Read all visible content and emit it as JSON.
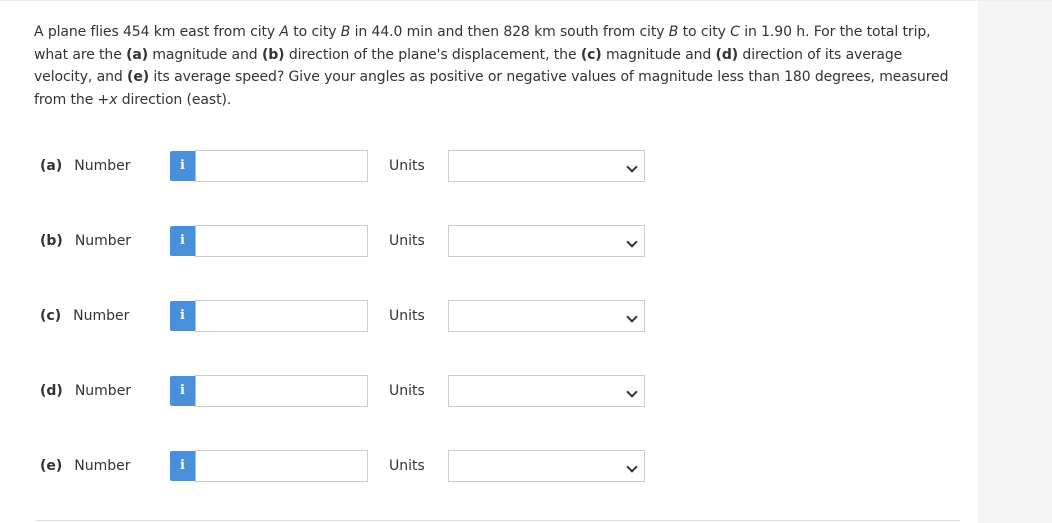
{
  "question": {
    "p1": "A plane flies 454 km east from city ",
    "cityA": "A",
    "p2": " to city ",
    "cityB": "B",
    "p3": " in 44.0 min and then 828 km south from city ",
    "cityB2": "B",
    "p4": " to city ",
    "cityC": "C",
    "p5": " in 1.90 h. For the total trip, what are the ",
    "a": "(a)",
    "p6": " magnitude and ",
    "b": "(b)",
    "p7": " direction of the plane's displacement, the ",
    "c": "(c)",
    "p8": " magnitude and ",
    "d": "(d)",
    "p9": " direction of its average velocity, and ",
    "e": "(e)",
    "p10": " its average speed? Give your angles as positive or negative values of magnitude less than 180 degrees, measured from the +",
    "x": "x",
    "p11": " direction (east)."
  },
  "rows": [
    {
      "letter": "(a)",
      "label": "Number",
      "info_glyph": "i",
      "value": "",
      "units_label": "Units",
      "units_selected": ""
    },
    {
      "letter": "(b)",
      "label": "Number",
      "info_glyph": "i",
      "value": "",
      "units_label": "Units",
      "units_selected": ""
    },
    {
      "letter": "(c)",
      "label": "Number",
      "info_glyph": "i",
      "value": "",
      "units_label": "Units",
      "units_selected": ""
    },
    {
      "letter": "(d)",
      "label": "Number",
      "info_glyph": "i",
      "value": "",
      "units_label": "Units",
      "units_selected": ""
    },
    {
      "letter": "(e)",
      "label": "Number",
      "info_glyph": "i",
      "value": "",
      "units_label": "Units",
      "units_selected": ""
    }
  ],
  "colors": {
    "info_button": "#4a8fd9",
    "text": "#333333",
    "input_border": "#cccccc",
    "gutter": "#f5f5f5"
  },
  "icons": {
    "info": "info-icon",
    "dropdown": "chevron-down-icon"
  }
}
